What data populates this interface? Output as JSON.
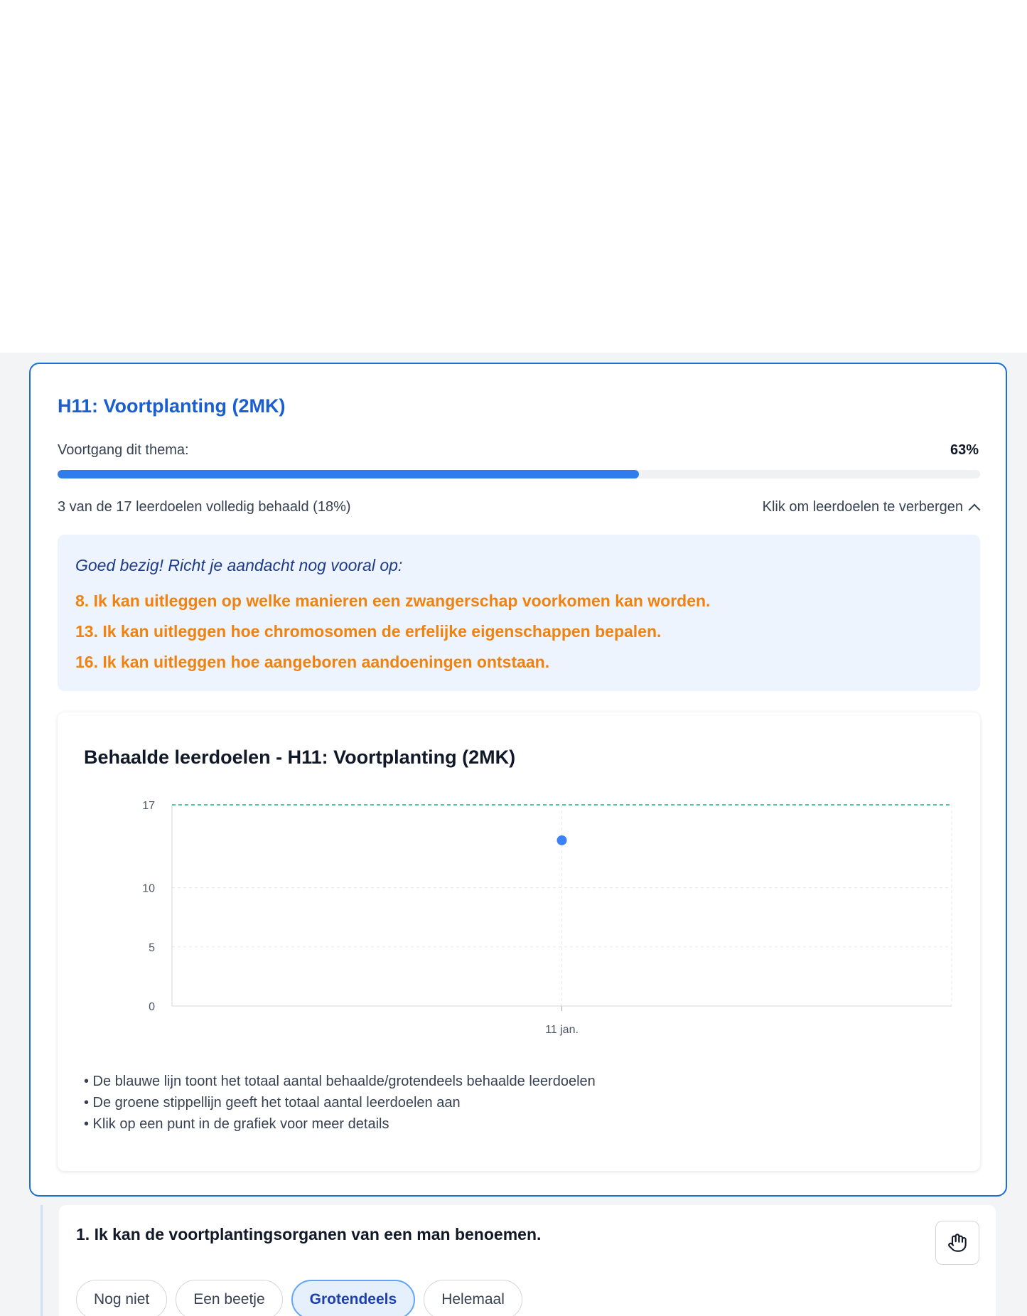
{
  "theme": {
    "title": "H11: Voortplanting (2MK)",
    "progress_label": "Voortgang dit thema:",
    "progress_text": "63%",
    "progress_fraction": 0.63,
    "summary": "3 van de 17 leerdoelen volledig behaald (18%)",
    "toggle_label": "Klik om leerdoelen te verbergen"
  },
  "focus": {
    "intro": "Goed bezig! Richt je aandacht nog vooral op:",
    "items": [
      "8. Ik kan uitleggen op welke manieren een zwangerschap voorkomen kan worden.",
      "13. Ik kan uitleggen hoe chromosomen de erfelijke eigenschappen bepalen.",
      "16. Ik kan uitleggen hoe aangeboren aandoeningen ontstaan."
    ]
  },
  "chart_data": {
    "type": "line",
    "title": "Behaalde leerdoelen - H11: Voortplanting (2MK)",
    "x": [
      "11 jan."
    ],
    "series": [
      {
        "values": [
          14
        ],
        "color": "#3b82f6"
      }
    ],
    "reference_line": {
      "value": 17,
      "color": "#10b981",
      "style": "dashed"
    },
    "yticks": [
      0,
      5,
      10,
      17
    ],
    "ylim": [
      0,
      17
    ],
    "grid": true,
    "xlabel": "",
    "ylabel": ""
  },
  "notes": [
    "• De blauwe lijn toont het totaal aantal behaalde/grotendeels behaalde leerdoelen",
    "• De groene stippellijn geeft het totaal aantal leerdoelen aan",
    "• Klik op een punt in de grafiek voor meer details"
  ],
  "goal": {
    "text": "1. Ik kan de voortplantingsorganen van een man benoemen.",
    "hand_icon": "hand-icon",
    "choices": [
      "Nog niet",
      "Een beetje",
      "Grotendeels",
      "Helemaal"
    ],
    "selected": "Grotendeels"
  },
  "colors": {
    "accent": "#1a6fd8",
    "focus_text": "#f0820f",
    "focus_bg": "#edf4fe"
  }
}
